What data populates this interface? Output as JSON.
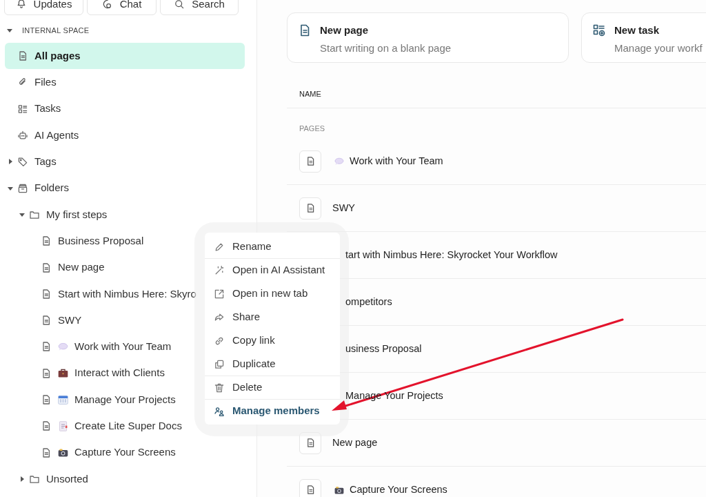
{
  "top_buttons": [
    {
      "label": "Updates",
      "kind": "updates"
    },
    {
      "label": "Chat",
      "kind": "chat"
    },
    {
      "label": "Search",
      "kind": "search"
    }
  ],
  "sidebar": {
    "section_label": "INTERNAL SPACE",
    "expanded": true,
    "items": [
      {
        "label": "All pages",
        "kind": "page",
        "selected": true
      },
      {
        "label": "Files",
        "kind": "files",
        "selected": false
      },
      {
        "label": "Tasks",
        "kind": "tasks",
        "selected": false
      },
      {
        "label": "AI Agents",
        "kind": "agents",
        "selected": false
      },
      {
        "label": "Tags",
        "kind": "tags",
        "selected": false,
        "expanded": false
      },
      {
        "label": "Folders",
        "kind": "folders",
        "selected": false,
        "expanded": true,
        "children": [
          {
            "label": "My first steps",
            "kind": "folder",
            "selected": false,
            "expanded": true,
            "children": [
              {
                "label": "Business Proposal",
                "kind": "page",
                "selected": false
              },
              {
                "label": "New page",
                "kind": "page",
                "selected": false
              },
              {
                "label": "Start with Nimbus Here: Skyro",
                "kind": "page",
                "selected": false
              },
              {
                "label": "SWY",
                "kind": "page",
                "selected": false
              },
              {
                "label": "Work with Your Team",
                "kind": "team",
                "selected": false
              },
              {
                "label": "Interact with Clients",
                "kind": "clients",
                "selected": false
              },
              {
                "label": "Manage Your Projects",
                "kind": "projects",
                "selected": false
              },
              {
                "label": "Create Lite Super Docs",
                "kind": "docs",
                "selected": false
              },
              {
                "label": "Capture Your Screens",
                "kind": "screens",
                "selected": false
              }
            ]
          },
          {
            "label": "Unsorted",
            "kind": "folder",
            "selected": false,
            "expanded": false
          }
        ]
      }
    ]
  },
  "quick_actions": [
    {
      "title": "New page",
      "subtitle": "Start writing on a blank page",
      "kind": "page"
    },
    {
      "title": "New task",
      "subtitle": "Manage your workf",
      "kind": "task"
    }
  ],
  "table": {
    "columns": [
      "NAME"
    ],
    "section_label": "PAGES",
    "rows": [
      {
        "label": "Work with Your Team",
        "kind": "team",
        "covered": false
      },
      {
        "label": "SWY",
        "kind": "plain",
        "covered": false
      },
      {
        "label": "tart with Nimbus Here: Skyrocket Your Workflow",
        "kind": "plain",
        "covered": true
      },
      {
        "label": "ompetitors",
        "kind": "plain",
        "covered": true
      },
      {
        "label": "usiness Proposal",
        "kind": "plain",
        "covered": true
      },
      {
        "label": "Manage Your Projects",
        "kind": "plain",
        "covered": true
      },
      {
        "label": "New page",
        "kind": "plain",
        "covered": false
      },
      {
        "label": "Capture Your Screens",
        "kind": "screens",
        "covered": false
      }
    ]
  },
  "context_menu": {
    "items": [
      {
        "label": "Rename",
        "kind": "rename",
        "separator_before": false,
        "highlighted": false
      },
      {
        "label": "Open in AI Assistant",
        "kind": "magic",
        "separator_before": true,
        "highlighted": false
      },
      {
        "label": "Open in new tab",
        "kind": "external",
        "separator_before": false,
        "highlighted": false
      },
      {
        "label": "Share",
        "kind": "share",
        "separator_before": false,
        "highlighted": false
      },
      {
        "label": "Copy link",
        "kind": "link",
        "separator_before": false,
        "highlighted": false
      },
      {
        "label": "Duplicate",
        "kind": "duplicate",
        "separator_before": false,
        "highlighted": false
      },
      {
        "label": "Delete",
        "kind": "delete",
        "separator_before": true,
        "highlighted": false
      },
      {
        "label": "Manage members",
        "kind": "members",
        "separator_before": true,
        "highlighted": true
      }
    ]
  },
  "annotations": [
    {
      "kind": "arrow"
    }
  ]
}
